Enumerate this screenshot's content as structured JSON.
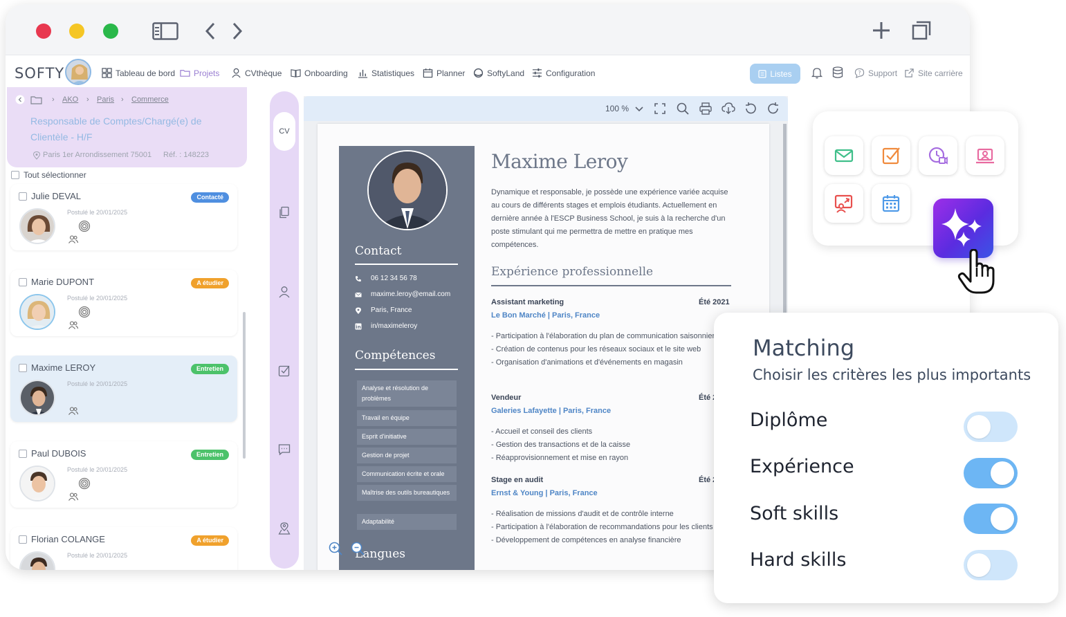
{
  "app": {
    "logo": "SOFTY",
    "nav": [
      {
        "label": "Tableau de bord",
        "icon": "dashboard-icon"
      },
      {
        "label": "Projets",
        "icon": "folder-icon"
      },
      {
        "label": "CVthèque",
        "icon": "user-icon"
      },
      {
        "label": "Onboarding",
        "icon": "book-icon"
      },
      {
        "label": "Statistiques",
        "icon": "chart-icon"
      },
      {
        "label": "Planner",
        "icon": "calendar-icon"
      },
      {
        "label": "SoftyLand",
        "icon": "globe-icon"
      },
      {
        "label": "Configuration",
        "icon": "sliders-icon"
      }
    ],
    "listes_label": "Listes",
    "support_label": "Support",
    "site_label": "Site carrière"
  },
  "job": {
    "breadcrumb": [
      "AKO",
      "Paris",
      "Commerce"
    ],
    "title": "Responsable de Comptes/Chargé(e) de Clientèle - H/F",
    "location": "Paris 1er Arrondissement 75001",
    "ref": "Réf. : 148223"
  },
  "select_all": "Tout sélectionner",
  "candidates": [
    {
      "name": "Julie DEVAL",
      "status": "Contacté",
      "status_color": "#4f8fe0",
      "date": "Postulé le 20/01/2025"
    },
    {
      "name": "Marie DUPONT",
      "status": "A étudier",
      "status_color": "#f0a12c",
      "date": "Postulé le 20/01/2025"
    },
    {
      "name": "Maxime LEROY",
      "status": "Entretien",
      "status_color": "#4cc26a",
      "date": "Postulé le 20/01/2025"
    },
    {
      "name": "Paul DUBOIS",
      "status": "Entretien",
      "status_color": "#4cc26a",
      "date": "Postulé le 20/01/2025"
    },
    {
      "name": "Florian COLANGE",
      "status": "A étudier",
      "status_color": "#f0a12c",
      "date": "Postulé le 20/01/2025"
    }
  ],
  "rail": {
    "cv_label": "CV"
  },
  "viewer": {
    "zoom": "100 %"
  },
  "cv": {
    "name": "Maxime Leroy",
    "summary": "Dynamique et responsable, je possède une expérience variée acquise au cours de différents stages et emplois étudiants. Actuellement en dernière année à l'ESCP Business School, je suis à la recherche d'un poste stimulant qui me permettra de mettre en pratique mes compétences.",
    "contact_title": "Contact",
    "phone": "06 12 34 56 78",
    "email": "maxime.leroy@email.com",
    "city": "Paris, France",
    "linkedin": "in/maximeleroy",
    "skills_title": "Compétences",
    "skills": [
      "Analyse et résolution de problèmes",
      "Travail en équipe",
      "Esprit d'initiative",
      "Gestion de projet",
      "Communication écrite et orale",
      "Maîtrise des outils bureautiques",
      "Adaptabilité"
    ],
    "languages_title": "Langues",
    "experience_title": "Expérience professionnelle",
    "jobs": [
      {
        "title": "Assistant marketing",
        "date": "Été 2021",
        "company": "Le Bon Marché | Paris, France",
        "bullets": "- Participation à l'élaboration du plan de communication saisonnier\n- Création de contenus pour les réseaux sociaux et le site web\n- Organisation d'animations et d'événements en magasin"
      },
      {
        "title": "Vendeur",
        "date": "Été 2",
        "company": "Galeries Lafayette | Paris, France",
        "bullets": "- Accueil et conseil des clients\n- Gestion des transactions et de la caisse\n- Réapprovisionnement et mise en rayon"
      },
      {
        "title": "Stage en audit",
        "date": "Été 2",
        "company": "Ernst & Young | Paris, France",
        "bullets": "- Réalisation de missions d'audit et de contrôle interne\n- Participation à l'élaboration de recommandations pour les clients\n- Développement de compétences en analyse financière"
      }
    ]
  },
  "actions": [
    {
      "icon": "mail-icon",
      "color": "#3fbf8a"
    },
    {
      "icon": "task-check-icon",
      "color": "#f08a3c"
    },
    {
      "icon": "video-schedule-icon",
      "color": "#a66de0"
    },
    {
      "icon": "laptop-user-icon",
      "color": "#e86aa0"
    },
    {
      "icon": "share-user-icon",
      "color": "#e8504e"
    },
    {
      "icon": "calendar-icon",
      "color": "#4f9ae8"
    }
  ],
  "matching": {
    "title": "Matching",
    "subtitle": "Choisir les critères les plus importants",
    "criteria": [
      {
        "label": "Diplôme",
        "enabled": false
      },
      {
        "label": "Expérience",
        "enabled": true
      },
      {
        "label": "Soft skills",
        "enabled": true
      },
      {
        "label": "Hard skills",
        "enabled": false
      }
    ]
  }
}
